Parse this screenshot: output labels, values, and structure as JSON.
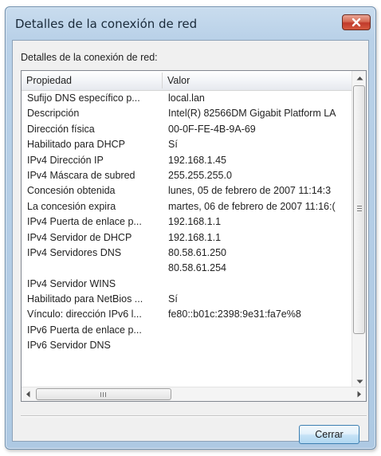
{
  "window": {
    "title": "Detalles de la conexión de red"
  },
  "group_label": "Detalles de la conexión de red:",
  "columns": [
    "Propiedad",
    "Valor"
  ],
  "rows": [
    [
      "Sufijo DNS específico p...",
      "local.lan"
    ],
    [
      "Descripción",
      "Intel(R) 82566DM Gigabit Platform LA"
    ],
    [
      "Dirección física",
      "00-0F-FE-4B-9A-69"
    ],
    [
      "Habilitado para DHCP",
      "Sí"
    ],
    [
      "IPv4 Dirección IP",
      "192.168.1.45"
    ],
    [
      "IPv4 Máscara de subred",
      "255.255.255.0"
    ],
    [
      "Concesión obtenida",
      "lunes, 05 de febrero de 2007 11:14:3"
    ],
    [
      "La concesión expira",
      "martes, 06 de febrero de 2007 11:16:("
    ],
    [
      "IPv4 Puerta de enlace p...",
      "192.168.1.1"
    ],
    [
      "IPv4 Servidor de DHCP",
      "192.168.1.1"
    ],
    [
      "IPv4 Servidores DNS",
      "80.58.61.250"
    ],
    [
      "",
      "80.58.61.254"
    ],
    [
      "IPv4 Servidor WINS",
      ""
    ],
    [
      "Habilitado para NetBios ...",
      "Sí"
    ],
    [
      "Vínculo: dirección IPv6 l...",
      "fe80::b01c:2398:9e31:fa7e%8"
    ],
    [
      "IPv6 Puerta de enlace p...",
      ""
    ],
    [
      "IPv6 Servidor DNS",
      ""
    ]
  ],
  "buttons": {
    "close_label": "Cerrar"
  },
  "icons": {
    "title_close": "close-icon",
    "scroll_up": "chevron-up-icon",
    "scroll_down": "chevron-down-icon",
    "scroll_left": "chevron-left-icon",
    "scroll_right": "chevron-right-icon"
  },
  "colors": {
    "close_button": "#c0392b",
    "title_bar": "#b9d1e8",
    "dialog_button_border": "#3c7fb1"
  }
}
